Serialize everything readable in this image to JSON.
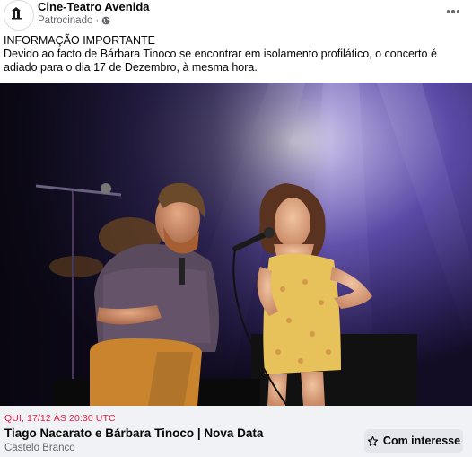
{
  "post": {
    "page_name": "Cine-Teatro Avenida",
    "sponsored_label": "Patrocinado",
    "sponsored_separator": "·",
    "text_heading": "INFORMAÇÃO IMPORTANTE",
    "text_body": "Devido ao facto de Bárbara Tinoco se encontrar em isolamento profilático, o concerto é adiado para o dia 17 de Dezembro, à mesma hora.",
    "avatar_logo_text": "CINE-TEATRO AVENIDA"
  },
  "event": {
    "date_label": "QUI, 17/12 ÀS 20:30 UTC",
    "title": "Tiago Nacarato e Bárbara Tinoco | Nova Data",
    "location": "Castelo Branco",
    "interest_button_label": "Com interesse"
  },
  "icons": {
    "more": "more-dots-icon",
    "globe": "globe-icon",
    "star": "star-outline-icon"
  },
  "colors": {
    "date_red": "#e41e3f",
    "secondary_text": "#65676b",
    "event_bar_bg": "#f0f2f5",
    "button_bg": "#e4e6eb"
  }
}
